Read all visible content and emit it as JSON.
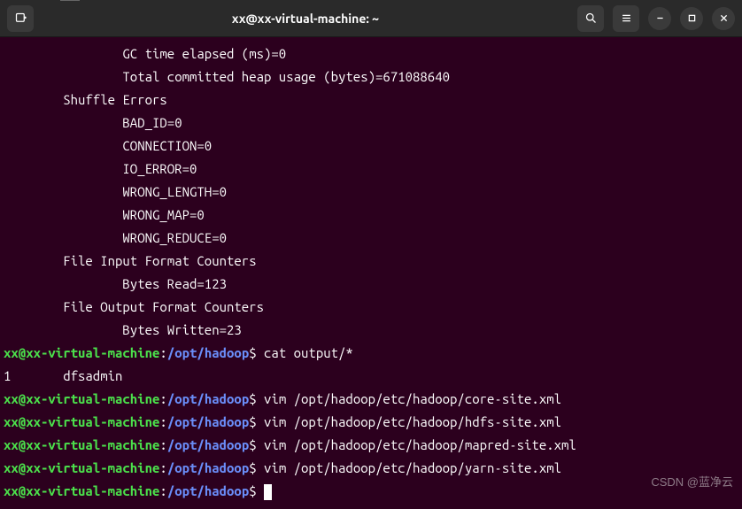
{
  "window": {
    "title": "xx@xx-virtual-machine: ~"
  },
  "prompt": {
    "user_host": "xx@xx-virtual-machine",
    "path": "/opt/hadoop",
    "symbol": "$"
  },
  "output_lines": [
    "                GC time elapsed (ms)=0",
    "                Total committed heap usage (bytes)=671088640",
    "        Shuffle Errors",
    "                BAD_ID=0",
    "                CONNECTION=0",
    "                IO_ERROR=0",
    "                WRONG_LENGTH=0",
    "                WRONG_MAP=0",
    "                WRONG_REDUCE=0",
    "        File Input Format Counters ",
    "                Bytes Read=123",
    "        File Output Format Counters ",
    "                Bytes Written=23"
  ],
  "history": [
    {
      "cmd": "cat output/*",
      "result": "1       dfsadmin"
    },
    {
      "cmd": "vim /opt/hadoop/etc/hadoop/core-site.xml"
    },
    {
      "cmd": "vim /opt/hadoop/etc/hadoop/hdfs-site.xml"
    },
    {
      "cmd": "vim /opt/hadoop/etc/hadoop/mapred-site.xml"
    },
    {
      "cmd": "vim /opt/hadoop/etc/hadoop/yarn-site.xml"
    }
  ],
  "watermark": "CSDN @蓝净云"
}
